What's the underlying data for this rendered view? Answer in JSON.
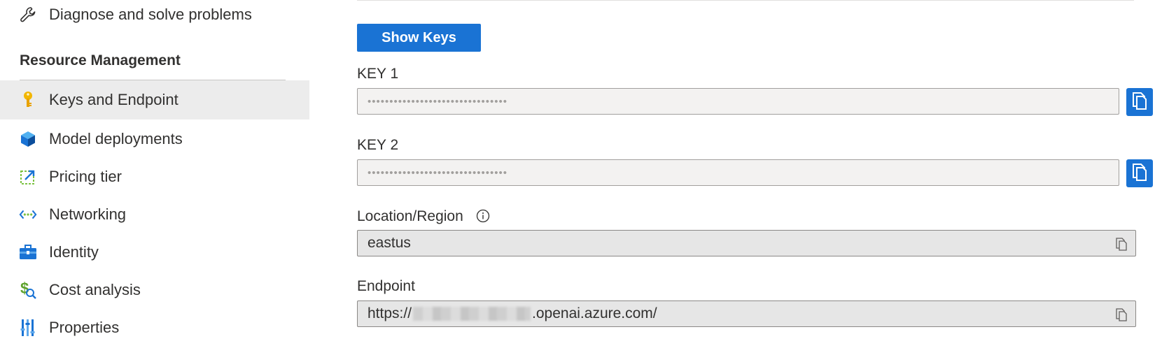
{
  "sidebar": {
    "items_top": [
      {
        "label": "Diagnose and solve problems",
        "icon": "wrench-icon"
      }
    ],
    "section_title": "Resource Management",
    "items": [
      {
        "label": "Keys and Endpoint",
        "icon": "key-icon",
        "active": true
      },
      {
        "label": "Model deployments",
        "icon": "cube-icon"
      },
      {
        "label": "Pricing tier",
        "icon": "pricing-tier-icon"
      },
      {
        "label": "Networking",
        "icon": "networking-icon"
      },
      {
        "label": "Identity",
        "icon": "identity-briefcase-icon"
      },
      {
        "label": "Cost analysis",
        "icon": "cost-analysis-icon"
      },
      {
        "label": "Properties",
        "icon": "properties-icon"
      }
    ]
  },
  "main": {
    "show_keys_label": "Show Keys",
    "key1": {
      "label": "KEY 1",
      "value": "••••••••••••••••••••••••••••••••"
    },
    "key2": {
      "label": "KEY 2",
      "value": "••••••••••••••••••••••••••••••••"
    },
    "location": {
      "label": "Location/Region",
      "value": "eastus"
    },
    "endpoint": {
      "label": "Endpoint",
      "prefix": "https://",
      "suffix": ".openai.azure.com/"
    }
  },
  "colors": {
    "accent": "#1a73d4",
    "active_row": "#ececec",
    "key_icon": "#f2b600"
  }
}
